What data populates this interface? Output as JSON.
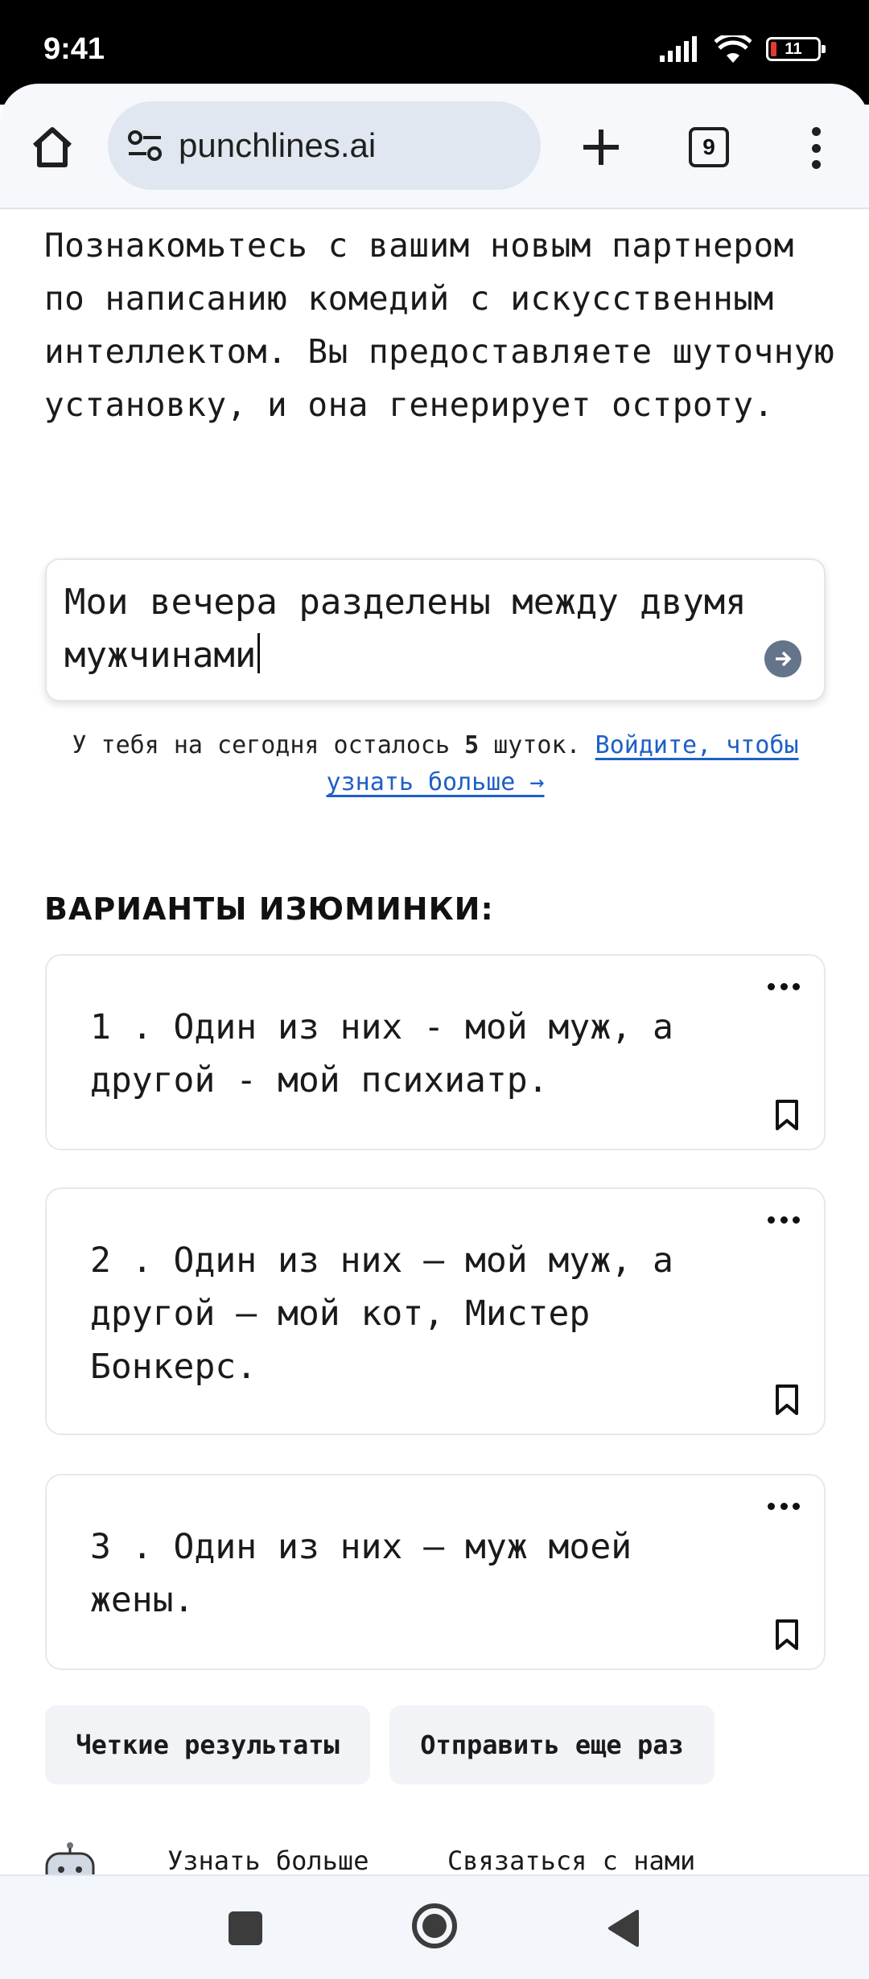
{
  "status_bar": {
    "time": "9:41",
    "battery_level": "11",
    "icons": [
      "signal-icon",
      "wifi-icon",
      "battery-icon"
    ]
  },
  "browser": {
    "url": "punchlines.ai",
    "tab_count": "9",
    "icons": [
      "home-icon",
      "site-settings-icon",
      "new-tab-icon",
      "tabs-icon",
      "more-menu-icon"
    ]
  },
  "intro": {
    "text": "Познакомьтесь с вашим новым партнером по написанию комедий с искусственным интеллектом. Вы предоставляете шуточную установку, и она генерирует остроту."
  },
  "prompt": {
    "value": "Мои вечера разделены между двумя мужчинами",
    "send_icon": "arrow-right-icon"
  },
  "quota": {
    "prefix": "У тебя на сегодня осталось ",
    "count": "5",
    "suffix": " шуток. ",
    "login_link": "Войдите, чтобы узнать больше →"
  },
  "results": {
    "title": "ВАРИАНТЫ ИЗЮМИНКИ:",
    "items": [
      {
        "text": "1 . Один из них - мой муж, а другой - мой психиатр."
      },
      {
        "text": "2 . Один из них — мой муж, а другой — мой кот, Мистер Бонкерс."
      },
      {
        "text": "3 . Один из них – муж моей жены."
      }
    ]
  },
  "actions": {
    "clear_label": "Четкие результаты",
    "resubmit_label": "Отправить еще раз"
  },
  "footer": {
    "learn_more": "Узнать больше",
    "contact": "Связаться с нами"
  },
  "colors": {
    "link": "#1d5fc7",
    "send_button": "#64748b",
    "button_bg": "#f1f3f6",
    "battery_low": "#e53935"
  }
}
